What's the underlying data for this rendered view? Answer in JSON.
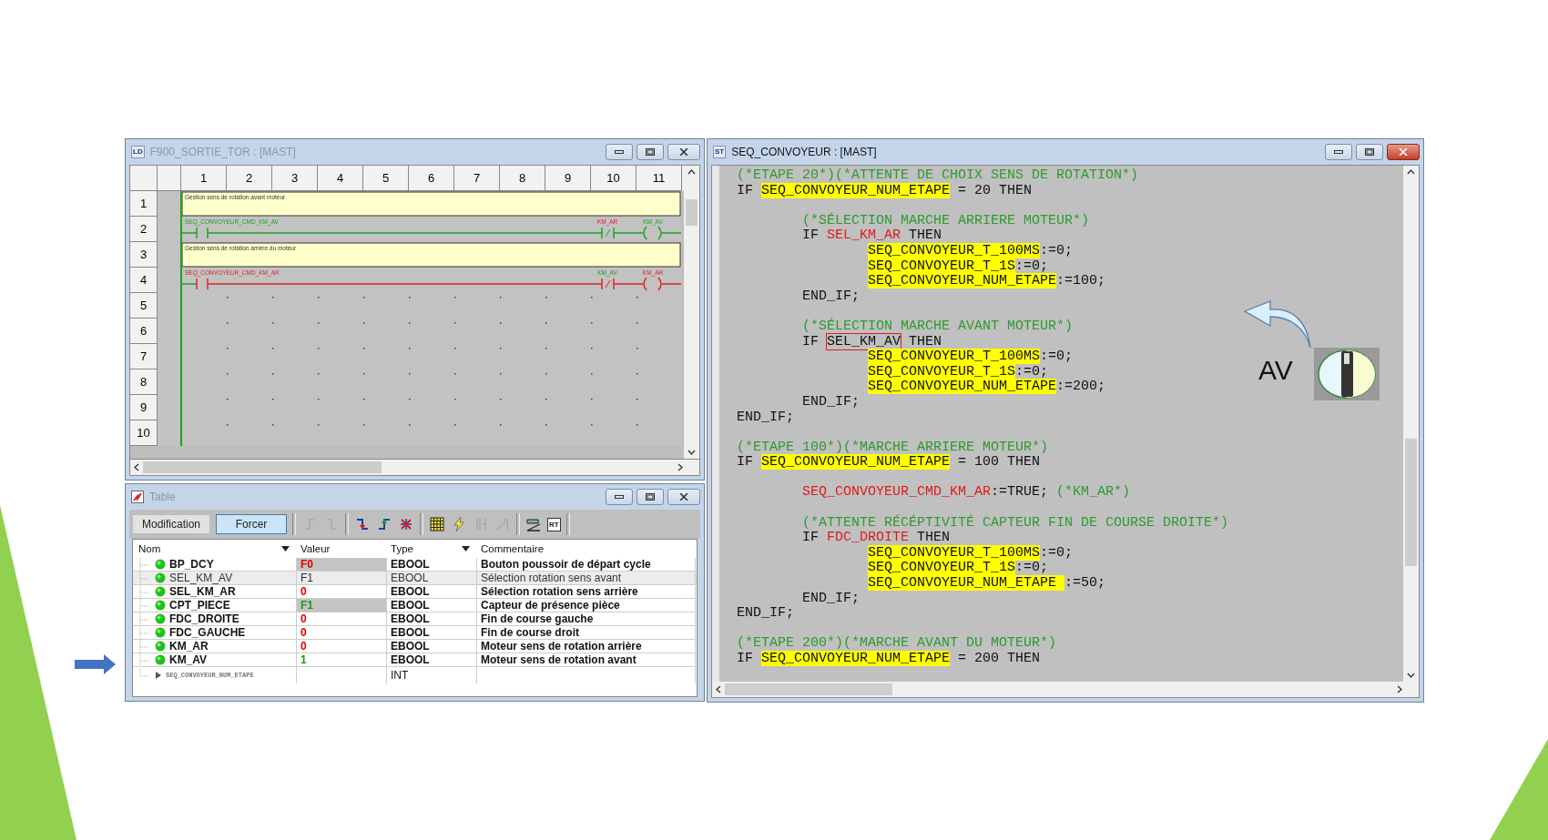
{
  "ladder_window": {
    "title": "F900_SORTIE_TOR : [MAST]",
    "icon_text": "LD",
    "active": false,
    "columns": [
      "1",
      "2",
      "3",
      "4",
      "5",
      "6",
      "7",
      "8",
      "9",
      "10",
      "11"
    ],
    "row_numbers": [
      "1",
      "2",
      "3",
      "4",
      "5",
      "6",
      "7",
      "8",
      "9",
      "10"
    ],
    "rows": [
      {
        "kind": "comment",
        "text": "Gestion sens de rotation avant moteur"
      },
      {
        "kind": "rung",
        "energized": true,
        "contact": {
          "label": "SEQ_CONVOYEUR_CMD_KM_AV",
          "energized": true
        },
        "negated_contact": {
          "label": "KM_AR",
          "energized": false
        },
        "coil": {
          "label": "KM_AV",
          "energized": true
        }
      },
      {
        "kind": "comment",
        "text": "Gestion sens de rotation arrière du moteur"
      },
      {
        "kind": "rung",
        "energized": false,
        "contact": {
          "label": "SEQ_CONVOYEUR_CMD_KM_AR",
          "energized": false
        },
        "negated_contact": {
          "label": "KM_AV",
          "energized": true
        },
        "coil": {
          "label": "KM_AR",
          "energized": false
        }
      }
    ]
  },
  "table_window": {
    "title": "Table",
    "active": false,
    "mode_buttons": [
      {
        "label": "Modification",
        "selected": false
      },
      {
        "label": "Forcer",
        "selected": true
      }
    ],
    "toolbar_groups": [
      [
        {
          "kind": "edge-rise",
          "disabled": true
        },
        {
          "kind": "edge-fall",
          "disabled": true
        }
      ],
      [
        {
          "kind": "force-low",
          "disabled": false
        },
        {
          "kind": "force-high",
          "disabled": false
        },
        {
          "kind": "unforce",
          "disabled": false
        }
      ],
      [
        {
          "kind": "grid",
          "disabled": false
        },
        {
          "kind": "bolt",
          "disabled": false
        },
        {
          "kind": "bracket",
          "disabled": true
        },
        {
          "kind": "bracket-arrow",
          "disabled": true
        }
      ],
      [
        {
          "kind": "slash-bar",
          "disabled": false
        },
        {
          "kind": "text",
          "text": "RT",
          "disabled": false
        }
      ]
    ],
    "columns": [
      {
        "label": "Nom",
        "filter": true
      },
      {
        "label": "Valeur",
        "filter": false
      },
      {
        "label": "Type",
        "filter": true
      },
      {
        "label": "Commentaire",
        "filter": false
      }
    ],
    "rows": [
      {
        "name": "BP_DCY",
        "value": "F0",
        "color": "#e00000",
        "forced": true,
        "selected": false,
        "type": "EBOOL",
        "comment": "Bouton poussoir de départ cycle"
      },
      {
        "name": "SEL_KM_AV",
        "value": "F1",
        "color": "#303030",
        "forced": true,
        "selected": true,
        "type": "EBOOL",
        "comment": "Sélection rotation sens avant"
      },
      {
        "name": "SEL_KM_AR",
        "value": "0",
        "color": "#e00000",
        "forced": false,
        "selected": false,
        "type": "EBOOL",
        "comment": "Sélection rotation sens arrière"
      },
      {
        "name": "CPT_PIECE",
        "value": "F1",
        "color": "#1a9a1a",
        "forced": true,
        "selected": false,
        "type": "EBOOL",
        "comment": "Capteur de présence pièce"
      },
      {
        "name": "FDC_DROITE",
        "value": "0",
        "color": "#e00000",
        "forced": false,
        "selected": false,
        "type": "EBOOL",
        "comment": "Fin de course gauche"
      },
      {
        "name": "FDC_GAUCHE",
        "value": "0",
        "color": "#e00000",
        "forced": false,
        "selected": false,
        "type": "EBOOL",
        "comment": "Fin de course droit"
      },
      {
        "name": "KM_AR",
        "value": "0",
        "color": "#e00000",
        "forced": false,
        "selected": false,
        "type": "EBOOL",
        "comment": "Moteur sens de rotation arrière"
      },
      {
        "name": "KM_AV",
        "value": "1",
        "color": "#1a9a1a",
        "forced": false,
        "selected": false,
        "type": "EBOOL",
        "comment": "Moteur sens de rotation avant"
      }
    ],
    "child_row": {
      "name": "SEQ_CONVOYEUR_NUM_ETAPE",
      "type": "INT",
      "expanded": false
    }
  },
  "code_window": {
    "title": "SEQ_CONVOYEUR : [MAST]",
    "icon_text": "ST",
    "active": true,
    "lines": [
      {
        "kind": "code",
        "segments": [
          {
            "kind": "comment",
            "text": "(*ETAPE 20*)(*ATTENTE DE CHOIX SENS DE ROTATION*)"
          }
        ]
      },
      {
        "kind": "code",
        "segments": [
          {
            "kind": "plain",
            "text": "IF "
          },
          {
            "kind": "var",
            "text": "SEQ_CONVOYEUR_NUM_ETAPE"
          },
          {
            "kind": "plain",
            "text": " = 20 THEN"
          }
        ],
        "children": [
          {
            "kind": "blank"
          },
          {
            "kind": "code",
            "segments": [
              {
                "kind": "comment",
                "text": "(*SÉLECTION MARCHE ARRIERE MOTEUR*)"
              }
            ]
          },
          {
            "kind": "code",
            "segments": [
              {
                "kind": "plain",
                "text": "IF "
              },
              {
                "kind": "red",
                "text": "SEL_KM_AR"
              },
              {
                "kind": "plain",
                "text": " THEN"
              }
            ],
            "children": [
              {
                "kind": "code",
                "segments": [
                  {
                    "kind": "var",
                    "text": "SEQ_CONVOYEUR_T_100MS"
                  },
                  {
                    "kind": "plain",
                    "text": ":=0;"
                  }
                ]
              },
              {
                "kind": "code",
                "segments": [
                  {
                    "kind": "var",
                    "text": "SEQ_CONVOYEUR_T_1S"
                  },
                  {
                    "kind": "plain",
                    "text": ":=0;"
                  }
                ]
              },
              {
                "kind": "code",
                "segments": [
                  {
                    "kind": "var",
                    "text": "SEQ_CONVOYEUR_NUM_ETAPE"
                  },
                  {
                    "kind": "plain",
                    "text": ":=100;"
                  }
                ]
              }
            ]
          },
          {
            "kind": "code",
            "segments": [
              {
                "kind": "plain",
                "text": "END_IF;"
              }
            ]
          },
          {
            "kind": "blank"
          },
          {
            "kind": "code",
            "segments": [
              {
                "kind": "comment",
                "text": "(*SÉLECTION MARCHE AVANT MOTEUR*)"
              }
            ]
          },
          {
            "kind": "code",
            "segments": [
              {
                "kind": "plain",
                "text": "IF "
              },
              {
                "kind": "boxed",
                "text": "SEL_KM_AV"
              },
              {
                "kind": "plain",
                "text": " THEN"
              }
            ],
            "children": [
              {
                "kind": "code",
                "segments": [
                  {
                    "kind": "var",
                    "text": "SEQ_CONVOYEUR_T_100MS"
                  },
                  {
                    "kind": "plain",
                    "text": ":=0;"
                  }
                ]
              },
              {
                "kind": "code",
                "segments": [
                  {
                    "kind": "var",
                    "text": "SEQ_CONVOYEUR_T_1S"
                  },
                  {
                    "kind": "plain",
                    "text": ":=0;"
                  }
                ]
              },
              {
                "kind": "code",
                "segments": [
                  {
                    "kind": "var",
                    "text": "SEQ_CONVOYEUR_NUM_ETAPE"
                  },
                  {
                    "kind": "plain",
                    "text": ":=200;"
                  }
                ]
              }
            ]
          },
          {
            "kind": "code",
            "segments": [
              {
                "kind": "plain",
                "text": "END_IF;"
              }
            ]
          }
        ]
      },
      {
        "kind": "code",
        "segments": [
          {
            "kind": "plain",
            "text": "END_IF;"
          }
        ]
      },
      {
        "kind": "blank"
      },
      {
        "kind": "code",
        "segments": [
          {
            "kind": "comment",
            "text": "(*ETAPE 100*)(*MARCHE ARRIERE MOTEUR*)"
          }
        ]
      },
      {
        "kind": "code",
        "segments": [
          {
            "kind": "plain",
            "text": "IF "
          },
          {
            "kind": "var",
            "text": "SEQ_CONVOYEUR_NUM_ETAPE"
          },
          {
            "kind": "plain",
            "text": " = 100 THEN"
          }
        ],
        "children": [
          {
            "kind": "blank"
          },
          {
            "kind": "code",
            "segments": [
              {
                "kind": "red",
                "text": "SEQ_CONVOYEUR_CMD_KM_AR"
              },
              {
                "kind": "plain",
                "text": ":=TRUE; "
              },
              {
                "kind": "comment",
                "text": "(*KM_AR*)"
              }
            ]
          },
          {
            "kind": "blank"
          },
          {
            "kind": "code",
            "segments": [
              {
                "kind": "comment",
                "text": "(*ATTENTE RÉCÉPTIVITÉ CAPTEUR FIN DE COURSE DROITE*)"
              }
            ]
          },
          {
            "kind": "code",
            "segments": [
              {
                "kind": "plain",
                "text": "IF "
              },
              {
                "kind": "red",
                "text": "FDC_DROITE"
              },
              {
                "kind": "plain",
                "text": " THEN"
              }
            ],
            "children": [
              {
                "kind": "code",
                "segments": [
                  {
                    "kind": "var",
                    "text": "SEQ_CONVOYEUR_T_100MS"
                  },
                  {
                    "kind": "plain",
                    "text": ":=0;"
                  }
                ]
              },
              {
                "kind": "code",
                "segments": [
                  {
                    "kind": "var",
                    "text": "SEQ_CONVOYEUR_T_1S"
                  },
                  {
                    "kind": "plain",
                    "text": ":=0;"
                  }
                ]
              },
              {
                "kind": "code",
                "segments": [
                  {
                    "kind": "var",
                    "text": "SEQ_CONVOYEUR_NUM_ETAPE "
                  },
                  {
                    "kind": "plain",
                    "text": ":=50;"
                  }
                ]
              }
            ]
          },
          {
            "kind": "code",
            "segments": [
              {
                "kind": "plain",
                "text": "END_IF;"
              }
            ]
          }
        ]
      },
      {
        "kind": "code",
        "segments": [
          {
            "kind": "plain",
            "text": "END_IF;"
          }
        ]
      },
      {
        "kind": "blank"
      },
      {
        "kind": "code",
        "segments": [
          {
            "kind": "comment",
            "text": "(*ETAPE 200*)(*MARCHE AVANT DU MOTEUR*)"
          }
        ]
      },
      {
        "kind": "code",
        "segments": [
          {
            "kind": "plain",
            "text": "IF "
          },
          {
            "kind": "var",
            "text": "SEQ_CONVOYEUR_NUM_ETAPE"
          },
          {
            "kind": "plain",
            "text": " = 200 THEN"
          }
        ]
      }
    ],
    "overlay": {
      "label": "AV"
    }
  }
}
